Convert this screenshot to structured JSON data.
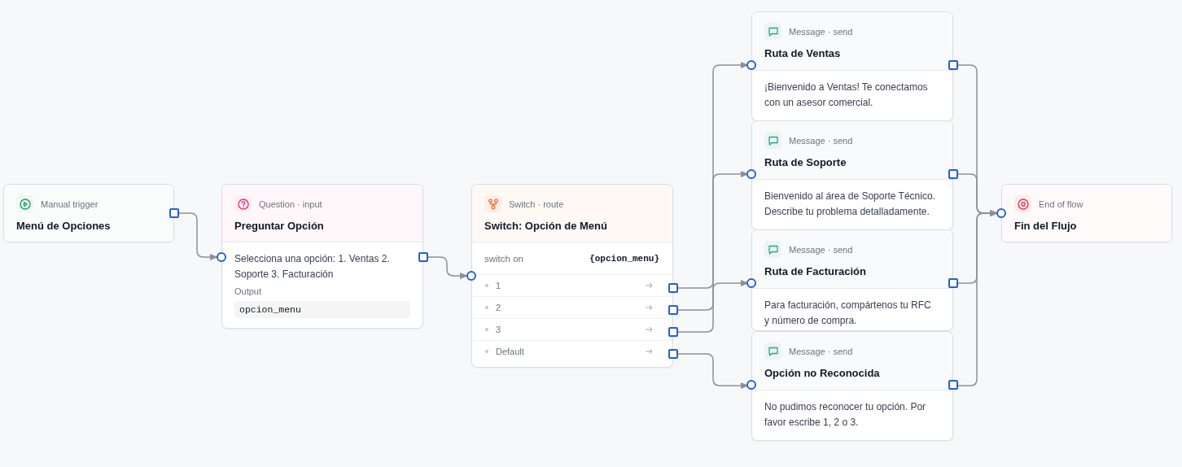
{
  "nodes": [
    {
      "kind": "trigger",
      "type_label": "Manual trigger",
      "title": "Menú de Opciones"
    },
    {
      "kind": "question",
      "type_label": "Question · input",
      "title": "Preguntar Opción",
      "prompt": "Selecciona una opción: 1. Ventas 2. Soporte 3. Facturación",
      "output_label": "Output",
      "output_value": "opcion_menu"
    },
    {
      "kind": "switch",
      "type_label": "Switch · route",
      "title": "Switch: Opción de Menú",
      "switch_label": "switch on",
      "switch_value": "{opcion_menu}",
      "cases": [
        {
          "label": "1"
        },
        {
          "label": "2"
        },
        {
          "label": "3"
        },
        {
          "label": "Default"
        }
      ]
    },
    {
      "kind": "message",
      "type_label": "Message · send",
      "title": "Ruta de Ventas",
      "body": "¡Bienvenido a Ventas! Te conectamos con un asesor comercial."
    },
    {
      "kind": "message",
      "type_label": "Message · send",
      "title": "Ruta de Soporte",
      "body": "Bienvenido al área de Soporte Técnico. Describe tu problema detalladamente."
    },
    {
      "kind": "message",
      "type_label": "Message · send",
      "title": "Ruta de Facturación",
      "body": "Para facturación, compártenos tu RFC y número de compra."
    },
    {
      "kind": "message",
      "type_label": "Message · send",
      "title": "Opción no Reconocida",
      "body": "No pudimos reconocer tu opción. Por favor escribe 1, 2 o 3."
    },
    {
      "kind": "end",
      "type_label": "End of flow",
      "title": "Fin del Flujo"
    }
  ]
}
